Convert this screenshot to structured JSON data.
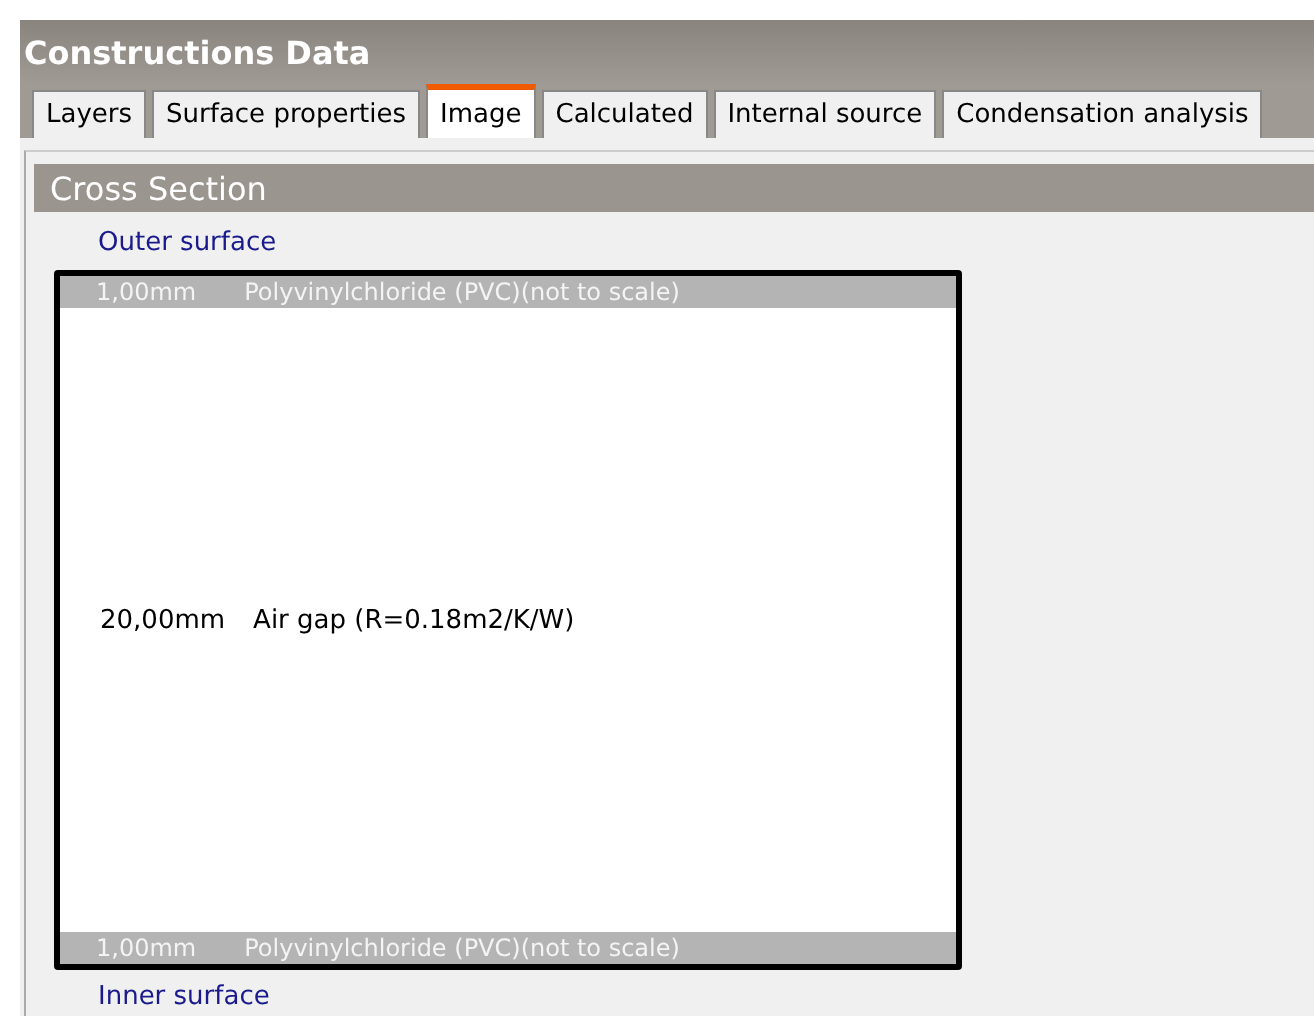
{
  "window": {
    "title": "Constructions Data"
  },
  "tabs": [
    {
      "label": "Layers",
      "selected": false
    },
    {
      "label": "Surface properties",
      "selected": false
    },
    {
      "label": "Image",
      "selected": true
    },
    {
      "label": "Calculated",
      "selected": false
    },
    {
      "label": "Internal source",
      "selected": false
    },
    {
      "label": "Condensation analysis",
      "selected": false
    }
  ],
  "section": {
    "title": "Cross Section",
    "outer_label": "Outer surface",
    "inner_label": "Inner surface",
    "layers": [
      {
        "kind": "band",
        "thickness": "1,00mm",
        "description": "Polyvinylchloride (PVC)(not to scale)"
      },
      {
        "kind": "gap",
        "thickness": "20,00mm",
        "description": "Air gap (R=0.18m2/K/W)"
      },
      {
        "kind": "band",
        "thickness": "1,00mm",
        "description": "Polyvinylchloride (PVC)(not to scale)"
      }
    ]
  }
}
